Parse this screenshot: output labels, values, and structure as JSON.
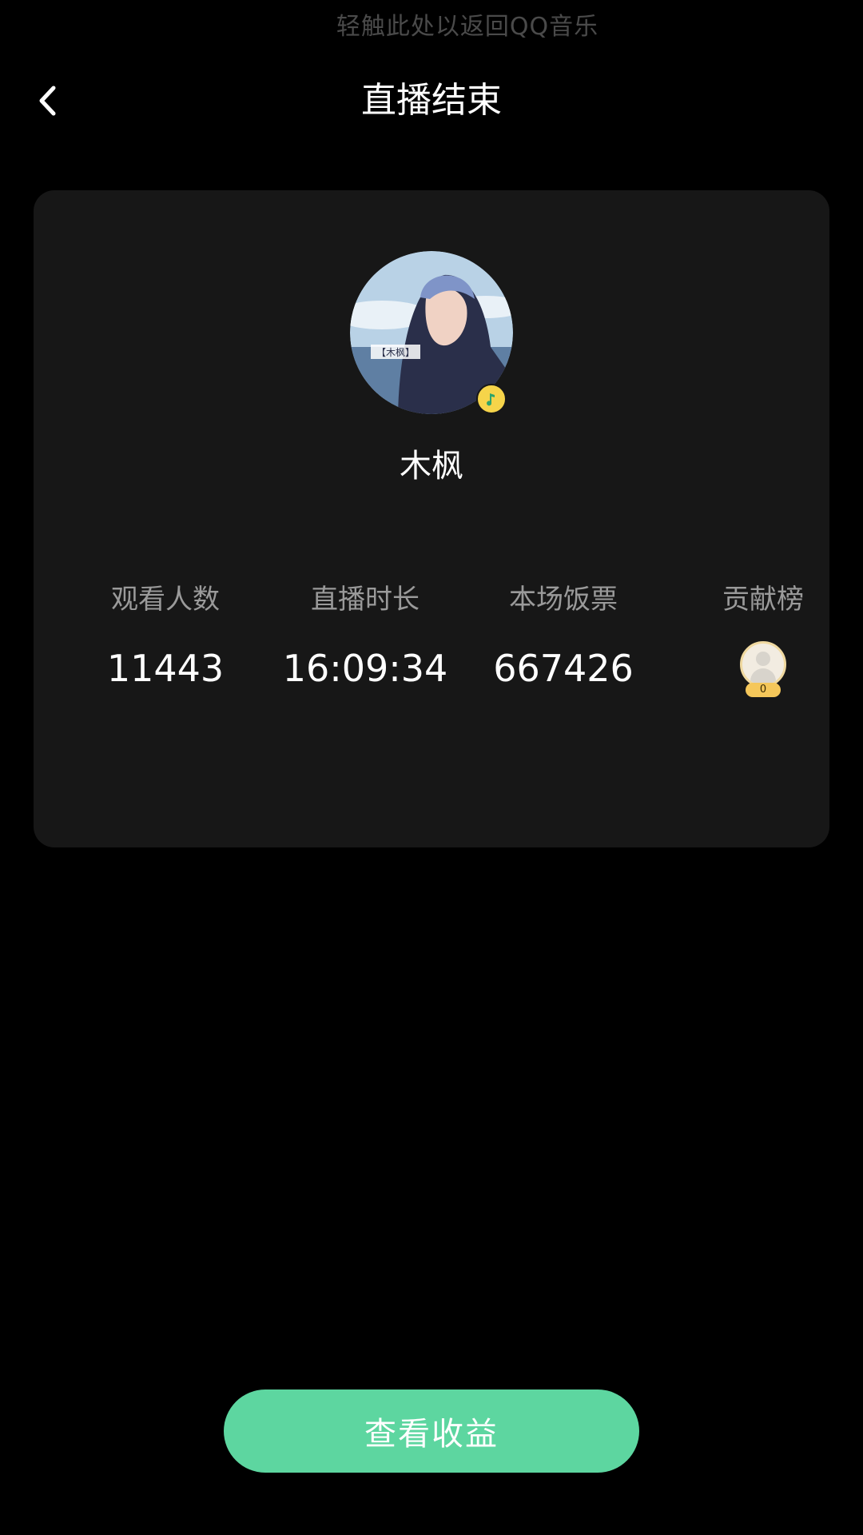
{
  "status_bar": {
    "return_hint": "轻触此处以返回QQ音乐"
  },
  "header": {
    "title": "直播结束",
    "back_icon": "chevron-left-icon"
  },
  "host": {
    "name": "木枫",
    "avatar_caption": "【木枫】",
    "badge_icon": "qq-music-note-icon",
    "badge_color": "#f6d44a"
  },
  "stats": [
    {
      "label": "观看人数",
      "value": "11443"
    },
    {
      "label": "直播时长",
      "value": "16:09:34"
    },
    {
      "label": "本场饭票",
      "value": "667426"
    },
    {
      "label": "贡献榜",
      "value": "0"
    }
  ],
  "cta": {
    "label": "查看收益",
    "color": "#5dd6a0"
  }
}
